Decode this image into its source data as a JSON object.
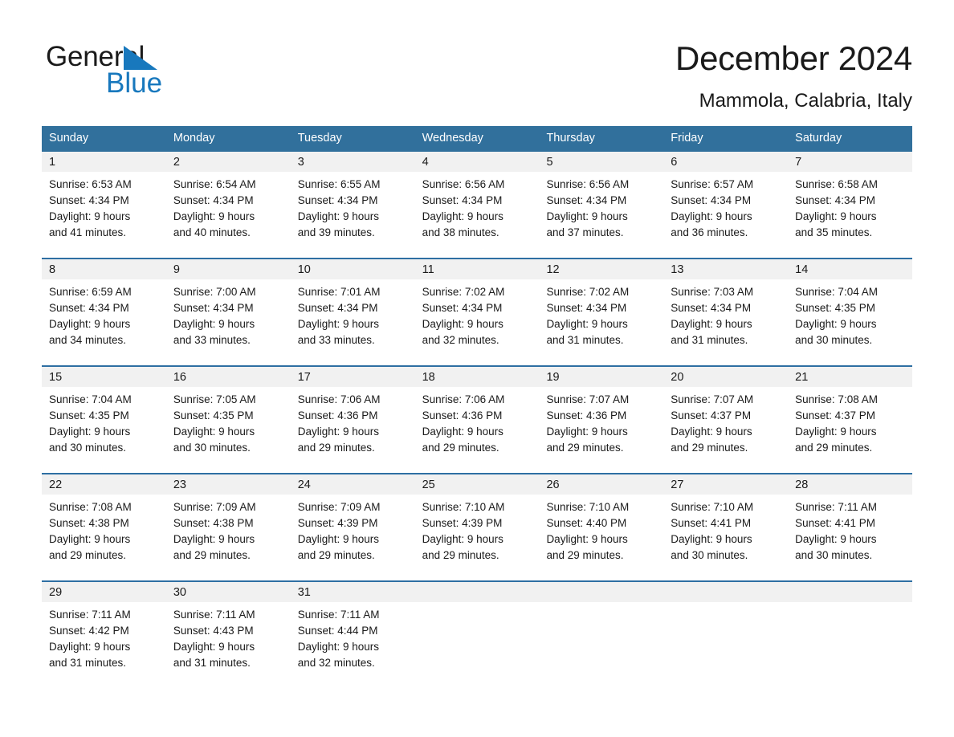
{
  "brand": {
    "name_part1": "General",
    "name_part2": "Blue",
    "flag_icon": "triangle-flag-icon",
    "accent_color": "#1878bd"
  },
  "header": {
    "title": "December 2024",
    "subtitle": "Mammola, Calabria, Italy"
  },
  "theme": {
    "header_blue": "#31709C",
    "rule_blue": "#2E6FA3",
    "daynum_gray": "#f1f1f1"
  },
  "weekdays": [
    "Sunday",
    "Monday",
    "Tuesday",
    "Wednesday",
    "Thursday",
    "Friday",
    "Saturday"
  ],
  "weeks": [
    [
      {
        "day": "1",
        "sunrise": "Sunrise: 6:53 AM",
        "sunset": "Sunset: 4:34 PM",
        "daylight1": "Daylight: 9 hours",
        "daylight2": "and 41 minutes."
      },
      {
        "day": "2",
        "sunrise": "Sunrise: 6:54 AM",
        "sunset": "Sunset: 4:34 PM",
        "daylight1": "Daylight: 9 hours",
        "daylight2": "and 40 minutes."
      },
      {
        "day": "3",
        "sunrise": "Sunrise: 6:55 AM",
        "sunset": "Sunset: 4:34 PM",
        "daylight1": "Daylight: 9 hours",
        "daylight2": "and 39 minutes."
      },
      {
        "day": "4",
        "sunrise": "Sunrise: 6:56 AM",
        "sunset": "Sunset: 4:34 PM",
        "daylight1": "Daylight: 9 hours",
        "daylight2": "and 38 minutes."
      },
      {
        "day": "5",
        "sunrise": "Sunrise: 6:56 AM",
        "sunset": "Sunset: 4:34 PM",
        "daylight1": "Daylight: 9 hours",
        "daylight2": "and 37 minutes."
      },
      {
        "day": "6",
        "sunrise": "Sunrise: 6:57 AM",
        "sunset": "Sunset: 4:34 PM",
        "daylight1": "Daylight: 9 hours",
        "daylight2": "and 36 minutes."
      },
      {
        "day": "7",
        "sunrise": "Sunrise: 6:58 AM",
        "sunset": "Sunset: 4:34 PM",
        "daylight1": "Daylight: 9 hours",
        "daylight2": "and 35 minutes."
      }
    ],
    [
      {
        "day": "8",
        "sunrise": "Sunrise: 6:59 AM",
        "sunset": "Sunset: 4:34 PM",
        "daylight1": "Daylight: 9 hours",
        "daylight2": "and 34 minutes."
      },
      {
        "day": "9",
        "sunrise": "Sunrise: 7:00 AM",
        "sunset": "Sunset: 4:34 PM",
        "daylight1": "Daylight: 9 hours",
        "daylight2": "and 33 minutes."
      },
      {
        "day": "10",
        "sunrise": "Sunrise: 7:01 AM",
        "sunset": "Sunset: 4:34 PM",
        "daylight1": "Daylight: 9 hours",
        "daylight2": "and 33 minutes."
      },
      {
        "day": "11",
        "sunrise": "Sunrise: 7:02 AM",
        "sunset": "Sunset: 4:34 PM",
        "daylight1": "Daylight: 9 hours",
        "daylight2": "and 32 minutes."
      },
      {
        "day": "12",
        "sunrise": "Sunrise: 7:02 AM",
        "sunset": "Sunset: 4:34 PM",
        "daylight1": "Daylight: 9 hours",
        "daylight2": "and 31 minutes."
      },
      {
        "day": "13",
        "sunrise": "Sunrise: 7:03 AM",
        "sunset": "Sunset: 4:34 PM",
        "daylight1": "Daylight: 9 hours",
        "daylight2": "and 31 minutes."
      },
      {
        "day": "14",
        "sunrise": "Sunrise: 7:04 AM",
        "sunset": "Sunset: 4:35 PM",
        "daylight1": "Daylight: 9 hours",
        "daylight2": "and 30 minutes."
      }
    ],
    [
      {
        "day": "15",
        "sunrise": "Sunrise: 7:04 AM",
        "sunset": "Sunset: 4:35 PM",
        "daylight1": "Daylight: 9 hours",
        "daylight2": "and 30 minutes."
      },
      {
        "day": "16",
        "sunrise": "Sunrise: 7:05 AM",
        "sunset": "Sunset: 4:35 PM",
        "daylight1": "Daylight: 9 hours",
        "daylight2": "and 30 minutes."
      },
      {
        "day": "17",
        "sunrise": "Sunrise: 7:06 AM",
        "sunset": "Sunset: 4:36 PM",
        "daylight1": "Daylight: 9 hours",
        "daylight2": "and 29 minutes."
      },
      {
        "day": "18",
        "sunrise": "Sunrise: 7:06 AM",
        "sunset": "Sunset: 4:36 PM",
        "daylight1": "Daylight: 9 hours",
        "daylight2": "and 29 minutes."
      },
      {
        "day": "19",
        "sunrise": "Sunrise: 7:07 AM",
        "sunset": "Sunset: 4:36 PM",
        "daylight1": "Daylight: 9 hours",
        "daylight2": "and 29 minutes."
      },
      {
        "day": "20",
        "sunrise": "Sunrise: 7:07 AM",
        "sunset": "Sunset: 4:37 PM",
        "daylight1": "Daylight: 9 hours",
        "daylight2": "and 29 minutes."
      },
      {
        "day": "21",
        "sunrise": "Sunrise: 7:08 AM",
        "sunset": "Sunset: 4:37 PM",
        "daylight1": "Daylight: 9 hours",
        "daylight2": "and 29 minutes."
      }
    ],
    [
      {
        "day": "22",
        "sunrise": "Sunrise: 7:08 AM",
        "sunset": "Sunset: 4:38 PM",
        "daylight1": "Daylight: 9 hours",
        "daylight2": "and 29 minutes."
      },
      {
        "day": "23",
        "sunrise": "Sunrise: 7:09 AM",
        "sunset": "Sunset: 4:38 PM",
        "daylight1": "Daylight: 9 hours",
        "daylight2": "and 29 minutes."
      },
      {
        "day": "24",
        "sunrise": "Sunrise: 7:09 AM",
        "sunset": "Sunset: 4:39 PM",
        "daylight1": "Daylight: 9 hours",
        "daylight2": "and 29 minutes."
      },
      {
        "day": "25",
        "sunrise": "Sunrise: 7:10 AM",
        "sunset": "Sunset: 4:39 PM",
        "daylight1": "Daylight: 9 hours",
        "daylight2": "and 29 minutes."
      },
      {
        "day": "26",
        "sunrise": "Sunrise: 7:10 AM",
        "sunset": "Sunset: 4:40 PM",
        "daylight1": "Daylight: 9 hours",
        "daylight2": "and 29 minutes."
      },
      {
        "day": "27",
        "sunrise": "Sunrise: 7:10 AM",
        "sunset": "Sunset: 4:41 PM",
        "daylight1": "Daylight: 9 hours",
        "daylight2": "and 30 minutes."
      },
      {
        "day": "28",
        "sunrise": "Sunrise: 7:11 AM",
        "sunset": "Sunset: 4:41 PM",
        "daylight1": "Daylight: 9 hours",
        "daylight2": "and 30 minutes."
      }
    ],
    [
      {
        "day": "29",
        "sunrise": "Sunrise: 7:11 AM",
        "sunset": "Sunset: 4:42 PM",
        "daylight1": "Daylight: 9 hours",
        "daylight2": "and 31 minutes."
      },
      {
        "day": "30",
        "sunrise": "Sunrise: 7:11 AM",
        "sunset": "Sunset: 4:43 PM",
        "daylight1": "Daylight: 9 hours",
        "daylight2": "and 31 minutes."
      },
      {
        "day": "31",
        "sunrise": "Sunrise: 7:11 AM",
        "sunset": "Sunset: 4:44 PM",
        "daylight1": "Daylight: 9 hours",
        "daylight2": "and 32 minutes."
      },
      {
        "day": "",
        "sunrise": "",
        "sunset": "",
        "daylight1": "",
        "daylight2": ""
      },
      {
        "day": "",
        "sunrise": "",
        "sunset": "",
        "daylight1": "",
        "daylight2": ""
      },
      {
        "day": "",
        "sunrise": "",
        "sunset": "",
        "daylight1": "",
        "daylight2": ""
      },
      {
        "day": "",
        "sunrise": "",
        "sunset": "",
        "daylight1": "",
        "daylight2": ""
      }
    ]
  ]
}
